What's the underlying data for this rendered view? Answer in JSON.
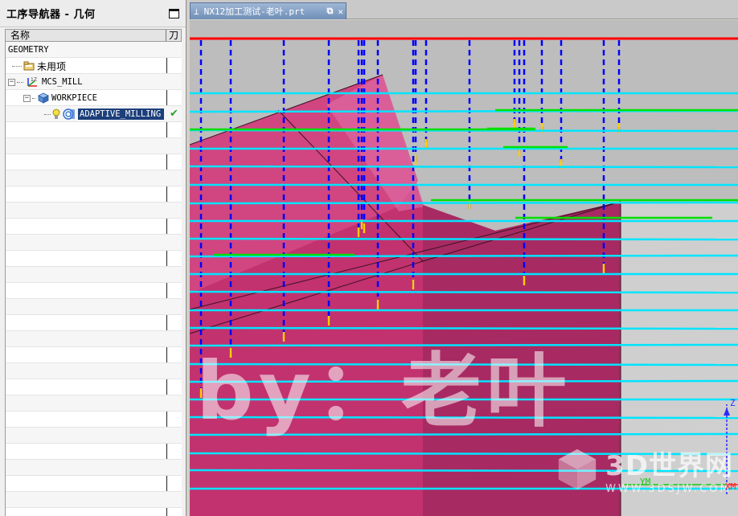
{
  "navigator": {
    "title": "工序导航器 - 几何",
    "columns": {
      "name": "名称",
      "tool": "刀"
    },
    "tree": [
      {
        "label": "GEOMETRY",
        "icon": "none"
      },
      {
        "label": "未用项",
        "icon": "folder-icon"
      },
      {
        "label": "MCS_MILL",
        "icon": "coordinate-system-icon"
      },
      {
        "label": "WORKPIECE",
        "icon": "workpiece-icon"
      },
      {
        "label": "ADAPTIVE_MILLING",
        "icon": "adaptive-milling-operation-icon",
        "selected": true,
        "status": "check"
      }
    ]
  },
  "document": {
    "tab_title": "NX12加工测试-老叶.prt"
  },
  "viewport": {
    "watermark": "by：老叶",
    "logo_main": "3D世界网",
    "logo_sub": "WWW.3DSJW.COM",
    "axes": {
      "ym": "YM",
      "z": "Z",
      "xm": "XM"
    },
    "colors": {
      "background": "#bdbdbd",
      "part": "#c0306f",
      "toolpath_cut": "#00e5ff",
      "toolpath_engage": "#00e000",
      "rapid": "#0000ff",
      "plunge": "#ffcc00",
      "clearance_plane": "#ff0000"
    }
  }
}
